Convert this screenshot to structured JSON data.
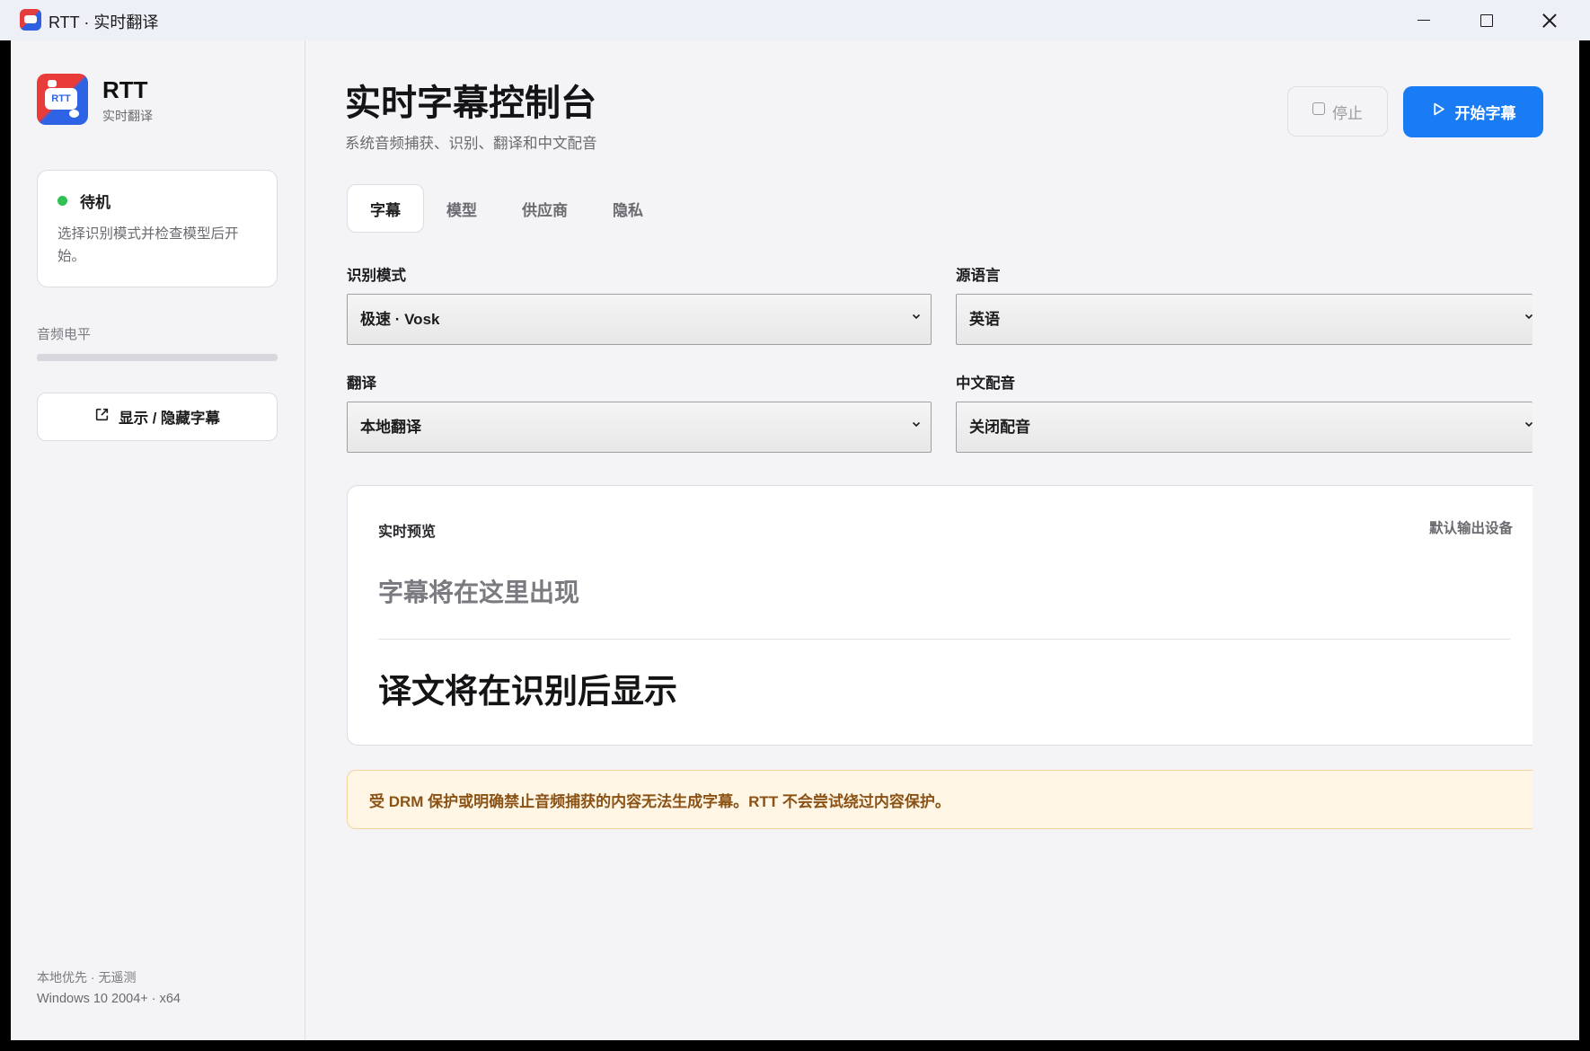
{
  "window": {
    "title": "RTT · 实时翻译"
  },
  "sidebar": {
    "brand_name": "RTT",
    "brand_sub": "实时翻译",
    "brand_logo_text": "RTT",
    "status": {
      "title": "待机",
      "description": "选择识别模式并检查模型后开始。",
      "dot_color": "#30c054"
    },
    "audio_level": {
      "label": "音频电平",
      "level": 0
    },
    "toggle_button": "显示 / 隐藏字幕",
    "footer_line1": "本地优先 · 无遥测",
    "footer_line2": "Windows 10 2004+ · x64"
  },
  "header": {
    "title": "实时字幕控制台",
    "subtitle": "系统音频捕获、识别、翻译和中文配音",
    "stop_label": "停止",
    "start_label": "开始字幕",
    "accent_color": "#1a7cf5"
  },
  "tabs": [
    {
      "label": "字幕",
      "active": true
    },
    {
      "label": "模型",
      "active": false
    },
    {
      "label": "供应商",
      "active": false
    },
    {
      "label": "隐私",
      "active": false
    }
  ],
  "settings": {
    "recognition_mode": {
      "label": "识别模式",
      "value": "极速 · Vosk"
    },
    "source_language": {
      "label": "源语言",
      "value": "英语"
    },
    "translation": {
      "label": "翻译",
      "value": "本地翻译"
    },
    "dubbing": {
      "label": "中文配音",
      "value": "关闭配音"
    }
  },
  "preview": {
    "title": "实时预览",
    "device": "默认输出设备",
    "source_placeholder": "字幕将在这里出现",
    "target_placeholder": "译文将在识别后显示"
  },
  "notice": {
    "text": "受 DRM 保护或明确禁止音频捕获的内容无法生成字幕。RTT 不会尝试绕过内容保护。",
    "bg_color": "#fff6e6",
    "text_color": "#8a5315"
  }
}
